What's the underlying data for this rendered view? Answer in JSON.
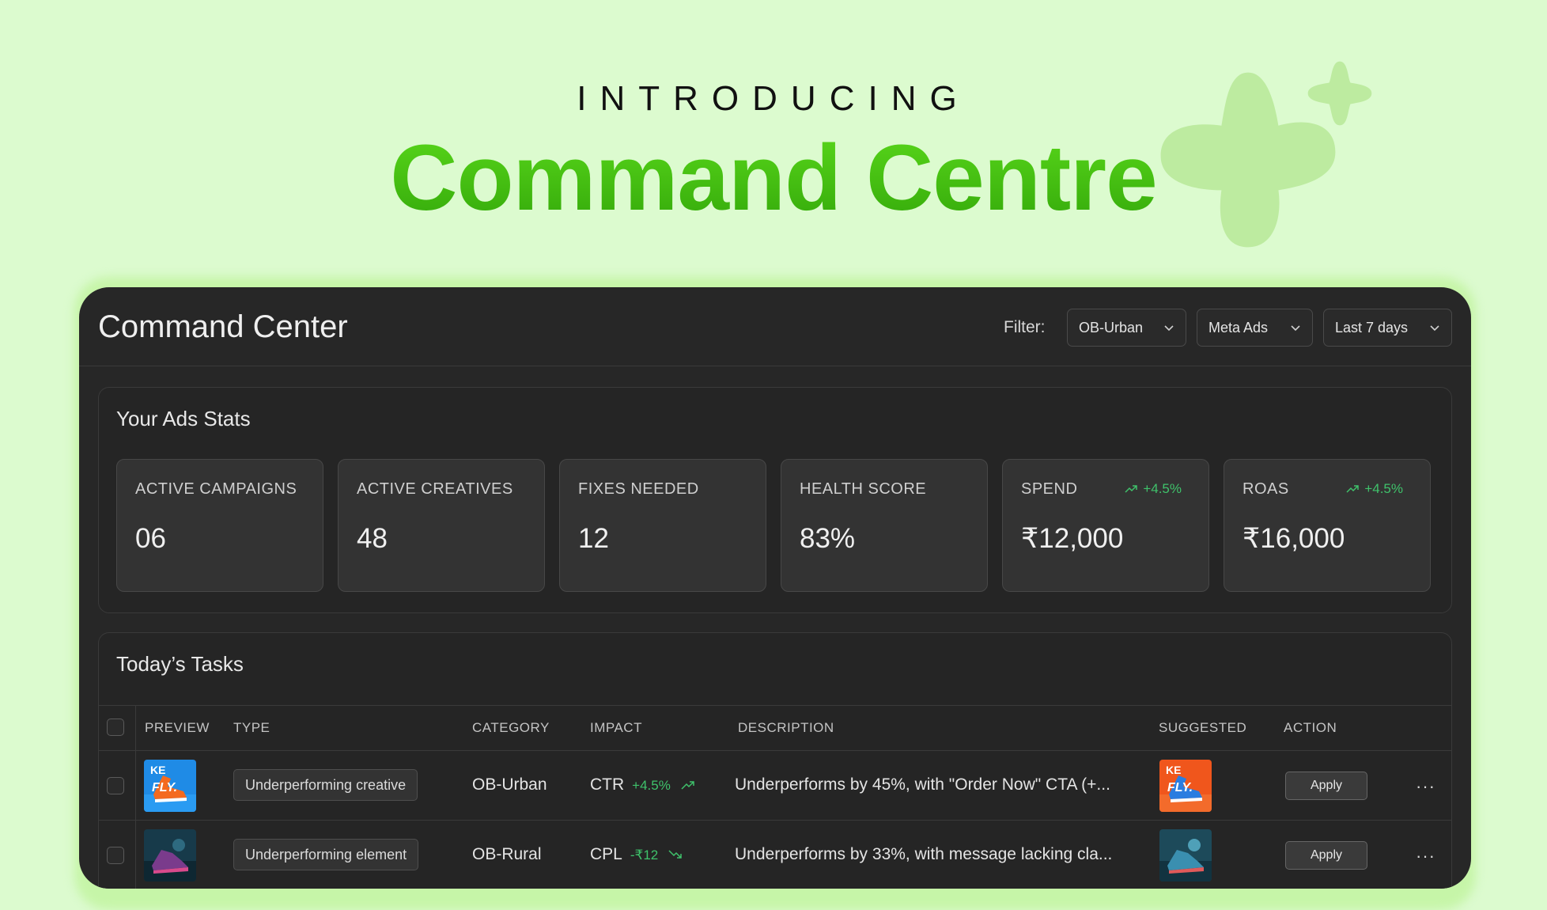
{
  "hero": {
    "eyebrow": "INTRODUCING",
    "title": "Command Centre",
    "accent_color": "#3fc20f"
  },
  "app": {
    "title": "Command Center",
    "filter_label": "Filter:",
    "filters": [
      {
        "value": "OB-Urban"
      },
      {
        "value": "Meta Ads"
      },
      {
        "value": "Last 7 days"
      }
    ]
  },
  "stats": {
    "title": "Your Ads Stats",
    "items": [
      {
        "label": "ACTIVE CAMPAIGNS",
        "value": "06",
        "trend": ""
      },
      {
        "label": "ACTIVE CREATIVES",
        "value": "48",
        "trend": ""
      },
      {
        "label": "FIXES NEEDED",
        "value": "12",
        "trend": ""
      },
      {
        "label": "HEALTH SCORE",
        "value": "83%",
        "trend": ""
      },
      {
        "label": "SPEND",
        "value": "₹12,000",
        "trend": "+4.5%"
      },
      {
        "label": "ROAS",
        "value": "₹16,000",
        "trend": "+4.5%"
      }
    ]
  },
  "tasks": {
    "title": "Today’s Tasks",
    "columns": [
      "PREVIEW",
      "TYPE",
      "CATEGORY",
      "IMPACT",
      "DESCRIPTION",
      "SUGGESTED",
      "ACTION"
    ],
    "rows": [
      {
        "type": "Underperforming creative",
        "category": "OB-Urban",
        "impact_metric": "CTR",
        "impact_delta": "+4.5%",
        "impact_direction": "up",
        "description": "Underperforms by 45%, with \"Order Now\" CTA (+...",
        "action": "Apply"
      },
      {
        "type": "Underperforming element",
        "category": "OB-Rural",
        "impact_metric": "CPL",
        "impact_delta": "-₹12",
        "impact_direction": "down",
        "description": "Underperforms by 33%, with message lacking cla...",
        "action": "Apply"
      }
    ]
  }
}
